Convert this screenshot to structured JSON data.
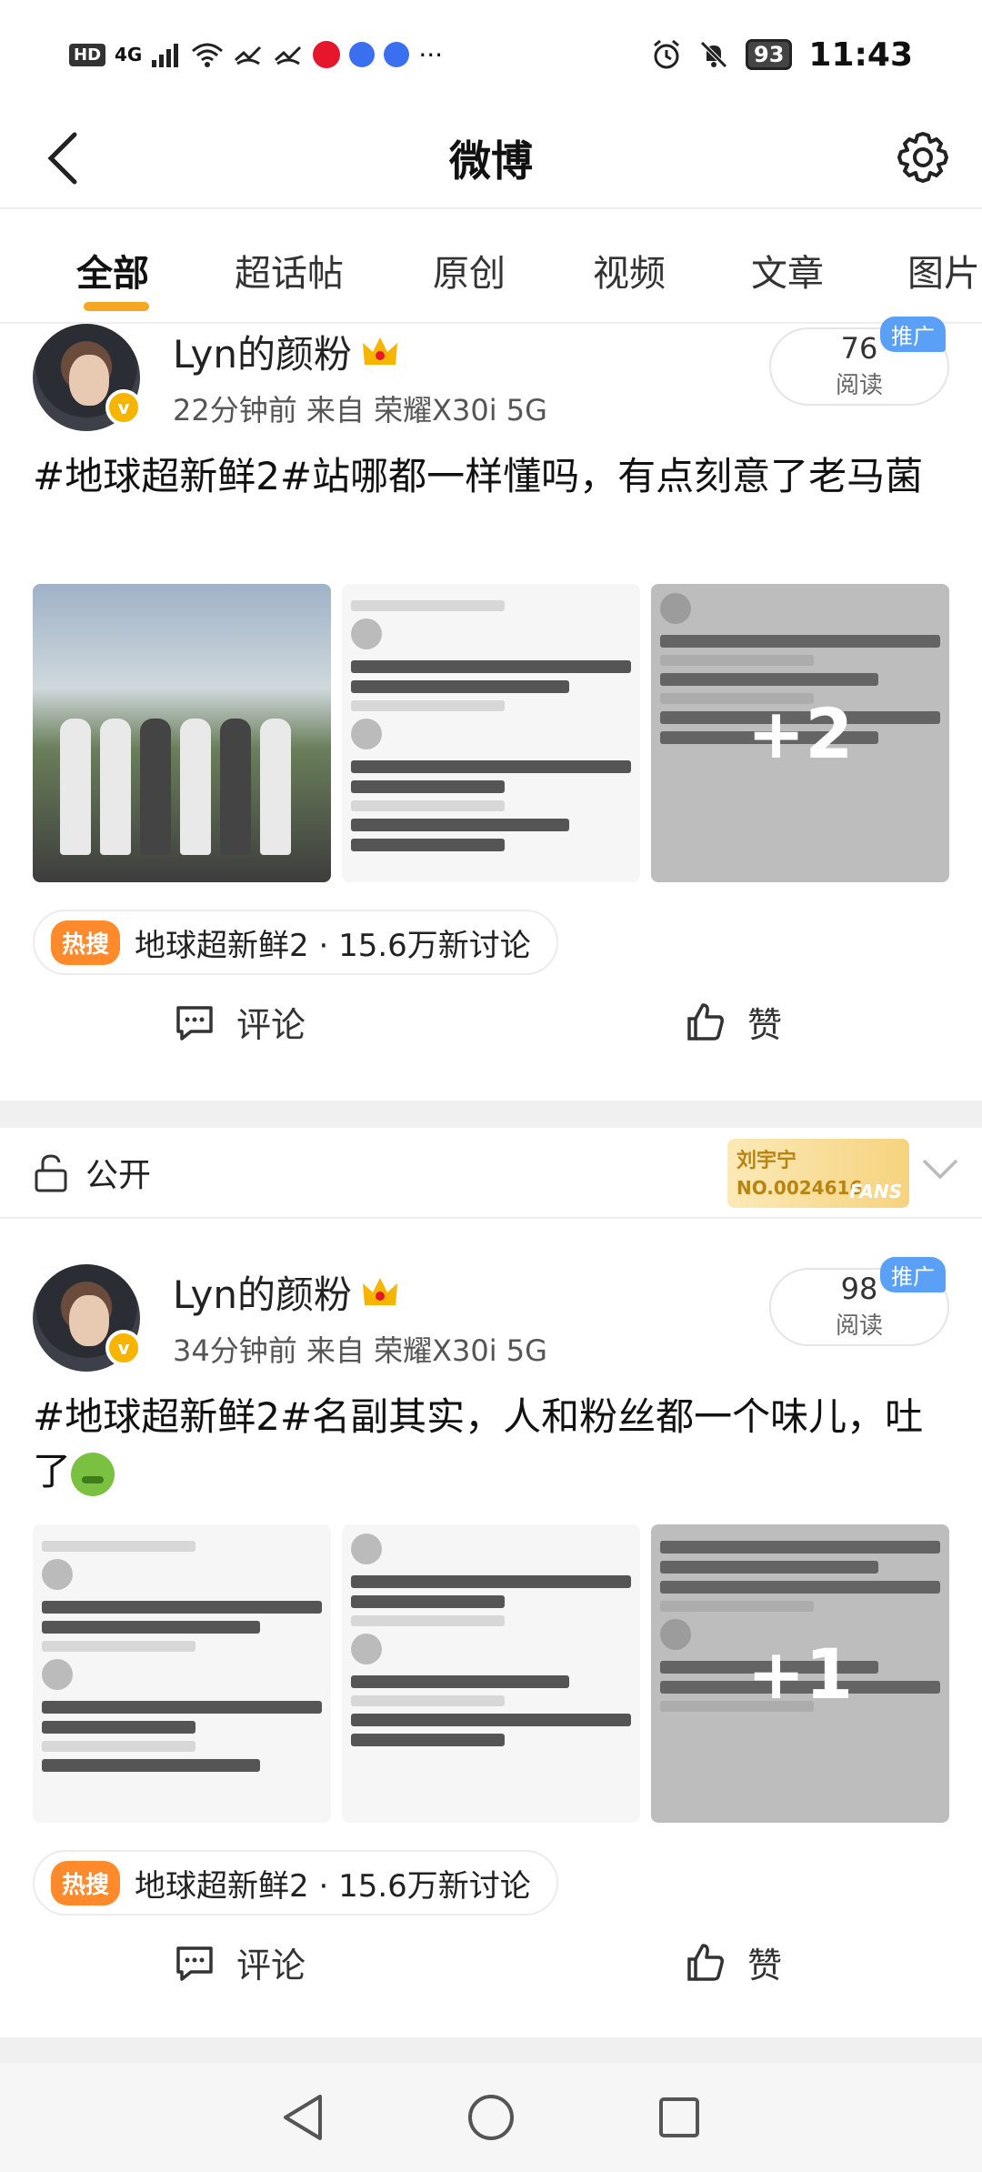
{
  "status_bar": {
    "hd": "HD",
    "network": "4G",
    "battery": "93",
    "time": "11:43"
  },
  "nav": {
    "title": "微博"
  },
  "tabs": [
    "全部",
    "超话帖",
    "原创",
    "视频",
    "文章",
    "图片"
  ],
  "posts": [
    {
      "author": "Lyn的颜粉",
      "meta": "22分钟前   来自 荣耀X30i 5G",
      "read_count": "76",
      "read_label": "阅读",
      "promo": "推广",
      "text": "#地球超新鲜2#站哪都一样懂吗，有点刻意了老马菌",
      "more_images": "+2",
      "hot_badge": "热搜",
      "topic": "地球超新鲜2 · 15.6万新讨论",
      "comment_label": "评论",
      "like_label": "赞"
    },
    {
      "author": "Lyn的颜粉",
      "meta": "34分钟前   来自 荣耀X30i 5G",
      "read_count": "98",
      "read_label": "阅读",
      "promo": "推广",
      "text": "#地球超新鲜2#名副其实，人和粉丝都一个味儿，吐了",
      "more_images": "+1",
      "hot_badge": "热搜",
      "topic": "地球超新鲜2 · 15.6万新讨论",
      "comment_label": "评论",
      "like_label": "赞"
    }
  ],
  "visibility": {
    "label": "公开",
    "fans_name": "刘宇宁",
    "fans_no": "NO.0024616",
    "fans_mark": "FANS"
  },
  "colors": {
    "accent": "#f5a623",
    "hot": "#ff8a2b",
    "promo": "#5aa0f7",
    "weibo_red": "#e6162d"
  }
}
